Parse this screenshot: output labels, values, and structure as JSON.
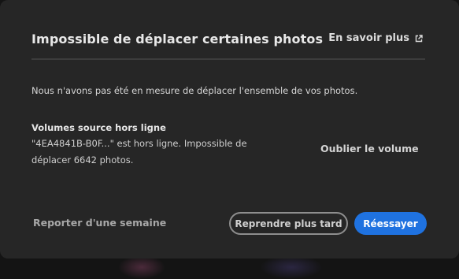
{
  "dialog": {
    "title": "Impossible de déplacer certaines photos",
    "learn_more_label": "En savoir plus",
    "learn_more_icon": "external-link-icon",
    "message": "Nous n'avons pas été en mesure de déplacer l'ensemble de vos photos.",
    "volume": {
      "title": "Volumes source hors ligne",
      "description": "\"4EA4841B-B0F...\" est hors ligne. Impossible de déplacer 6642 photos.",
      "forget_label": "Oublier le volume"
    },
    "footer": {
      "postpone_label": "Reporter d'une semaine",
      "later_label": "Reprendre plus tard",
      "retry_label": "Réessayer"
    }
  },
  "colors": {
    "dialog_bg": "#262626",
    "primary_button": "#1f72e0",
    "divider": "#3c3c3c"
  }
}
